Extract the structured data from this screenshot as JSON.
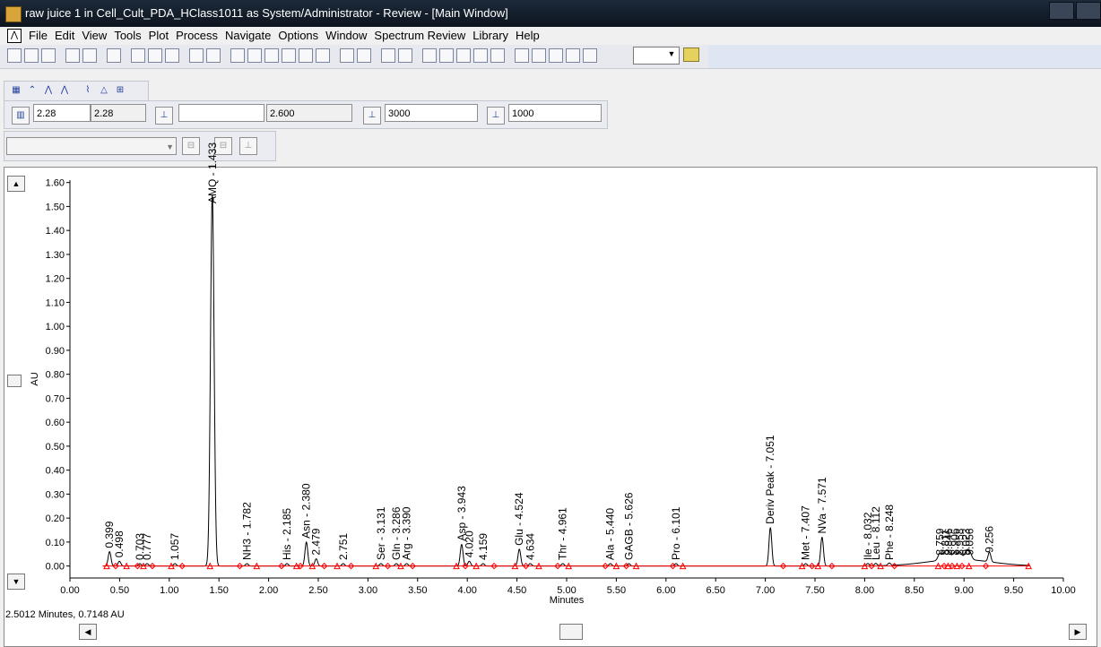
{
  "window": {
    "title": "raw juice 1 in Cell_Cult_PDA_HClass1011 as System/Administrator - Review - [Main Window]"
  },
  "menu": {
    "items": [
      "File",
      "Edit",
      "View",
      "Tools",
      "Plot",
      "Process",
      "Navigate",
      "Options",
      "Window",
      "Spectrum Review",
      "Library",
      "Help"
    ]
  },
  "integration": {
    "start_time": "2.28",
    "end_time": "2.28",
    "threshold_value": "",
    "threshold_readout": "2.600",
    "min_area": "3000",
    "min_height": "1000"
  },
  "status": {
    "cursor_readout": "2.5012 Minutes, 0.7148 AU"
  },
  "chart_data": {
    "type": "line",
    "title": "",
    "xlabel": "Minutes",
    "ylabel": "AU",
    "xlim": [
      0,
      10
    ],
    "ylim": [
      -0.05,
      1.61
    ],
    "x_ticks": [
      "0.00",
      "0.50",
      "1.00",
      "1.50",
      "2.00",
      "2.50",
      "3.00",
      "3.50",
      "4.00",
      "4.50",
      "5.00",
      "5.50",
      "6.00",
      "6.50",
      "7.00",
      "7.50",
      "8.00",
      "8.50",
      "9.00",
      "9.50",
      "10.00"
    ],
    "y_ticks": [
      "0.00",
      "0.10",
      "0.20",
      "0.30",
      "0.40",
      "0.50",
      "0.60",
      "0.70",
      "0.80",
      "0.90",
      "1.00",
      "1.10",
      "1.20",
      "1.30",
      "1.40",
      "1.50",
      "1.60"
    ],
    "peaks": [
      {
        "label": "0.399",
        "rt": 0.399,
        "height": 0.06
      },
      {
        "label": "0.498",
        "rt": 0.498,
        "height": 0.02
      },
      {
        "label": "0.703",
        "rt": 0.703,
        "height": 0.01
      },
      {
        "label": "0.777",
        "rt": 0.777,
        "height": 0.01
      },
      {
        "label": "1.057",
        "rt": 1.057,
        "height": 0.01
      },
      {
        "label": "AMQ - 1.433",
        "rt": 1.433,
        "height": 1.55
      },
      {
        "label": "NH3 - 1.782",
        "rt": 1.782,
        "height": 0.01
      },
      {
        "label": "His - 2.185",
        "rt": 2.185,
        "height": 0.01
      },
      {
        "label": "Asn - 2.380",
        "rt": 2.38,
        "height": 0.1
      },
      {
        "label": "2.479",
        "rt": 2.479,
        "height": 0.03
      },
      {
        "label": "2.751",
        "rt": 2.751,
        "height": 0.01
      },
      {
        "label": "Ser - 3.131",
        "rt": 3.131,
        "height": 0.01
      },
      {
        "label": "Gln - 3.286",
        "rt": 3.286,
        "height": 0.01
      },
      {
        "label": "Arg - 3.390",
        "rt": 3.39,
        "height": 0.01
      },
      {
        "label": "Asp - 3.943",
        "rt": 3.943,
        "height": 0.09
      },
      {
        "label": "4.020",
        "rt": 4.02,
        "height": 0.02
      },
      {
        "label": "4.159",
        "rt": 4.159,
        "height": 0.01
      },
      {
        "label": "Glu - 4.524",
        "rt": 4.524,
        "height": 0.07
      },
      {
        "label": "4.634",
        "rt": 4.634,
        "height": 0.01
      },
      {
        "label": "Thr - 4.961",
        "rt": 4.961,
        "height": 0.01
      },
      {
        "label": "Ala - 5.440",
        "rt": 5.44,
        "height": 0.01
      },
      {
        "label": "GAGB - 5.626",
        "rt": 5.626,
        "height": 0.01
      },
      {
        "label": "Pro - 6.101",
        "rt": 6.101,
        "height": 0.01
      },
      {
        "label": "Deriv Peak - 7.051",
        "rt": 7.051,
        "height": 0.16
      },
      {
        "label": "Met - 7.407",
        "rt": 7.407,
        "height": 0.01
      },
      {
        "label": "NVa - 7.571",
        "rt": 7.571,
        "height": 0.12
      },
      {
        "label": "Ile - 8.032",
        "rt": 8.032,
        "height": 0.01
      },
      {
        "label": "Leu - 8.112",
        "rt": 8.112,
        "height": 0.01
      },
      {
        "label": "Phe - 8.248",
        "rt": 8.248,
        "height": 0.01
      },
      {
        "label": "8.759",
        "rt": 8.759,
        "height": 0.03
      },
      {
        "label": "8.811",
        "rt": 8.811,
        "height": 0.03
      },
      {
        "label": "8.846",
        "rt": 8.846,
        "height": 0.03
      },
      {
        "label": "8.906",
        "rt": 8.906,
        "height": 0.03
      },
      {
        "label": "8.958",
        "rt": 8.958,
        "height": 0.03
      },
      {
        "label": "9.023",
        "rt": 9.023,
        "height": 0.03
      },
      {
        "label": "9.056",
        "rt": 9.056,
        "height": 0.03
      },
      {
        "label": "9.256",
        "rt": 9.256,
        "height": 0.04
      }
    ],
    "baseline_markers": [
      0.37,
      0.46,
      0.57,
      0.68,
      0.74,
      0.83,
      1.02,
      1.13,
      1.41,
      1.71,
      1.88,
      2.13,
      2.28,
      2.32,
      2.44,
      2.56,
      2.69,
      2.83,
      3.08,
      3.2,
      3.33,
      3.45,
      3.89,
      3.98,
      4.09,
      4.27,
      4.48,
      4.59,
      4.72,
      4.91,
      5.02,
      5.39,
      5.5,
      5.6,
      5.7,
      6.07,
      6.17,
      7.18,
      7.37,
      7.47,
      7.53,
      7.67,
      8.0,
      8.07,
      8.16,
      8.3,
      8.74,
      8.8,
      8.84,
      8.88,
      8.93,
      8.98,
      9.05,
      9.22,
      9.65
    ],
    "colors": {
      "trace": "#000000",
      "baseline": "#ff0000"
    }
  }
}
